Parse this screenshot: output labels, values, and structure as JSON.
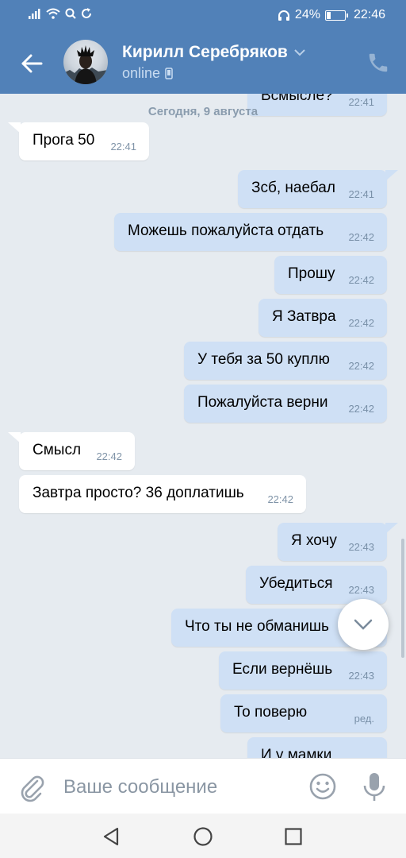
{
  "status_bar": {
    "battery": "24%",
    "battery_level": 0.24,
    "time": "22:46"
  },
  "header": {
    "contact_name": "Кирилл Серебряков",
    "status": "online",
    "icons": [
      "back-arrow-icon",
      "chevron-down-icon",
      "mobile-icon",
      "phone-icon"
    ]
  },
  "chat": {
    "date_separator": "Сегодня, 9 августа",
    "partial_top": {
      "text": "Всмысле?",
      "time": "22:41"
    },
    "messages": [
      {
        "dir": "in",
        "text": "Прога 50",
        "time": "22:41",
        "tail": true
      },
      {
        "dir": "out",
        "text": "Зсб, наебал",
        "time": "22:41",
        "tail": true
      },
      {
        "dir": "out",
        "text": "Можешь пожалуйста отдать",
        "time": "22:42",
        "tail": false
      },
      {
        "dir": "out",
        "text": "Прошу",
        "time": "22:42",
        "tail": false
      },
      {
        "dir": "out",
        "text": "Я Затвра",
        "time": "22:42",
        "tail": false
      },
      {
        "dir": "out",
        "text": "У тебя за 50 куплю",
        "time": "22:42",
        "tail": false
      },
      {
        "dir": "out",
        "text": "Пожалуйста верни",
        "time": "22:42",
        "tail": false
      },
      {
        "dir": "in",
        "text": "Смысл",
        "time": "22:42",
        "tail": true
      },
      {
        "dir": "in",
        "text": "Завтра просто? 36 доплатишь",
        "time": "22:42",
        "tail": false
      },
      {
        "dir": "out",
        "text": "Я хочу",
        "time": "22:43",
        "tail": true
      },
      {
        "dir": "out",
        "text": "Убедиться",
        "time": "22:43",
        "tail": false
      },
      {
        "dir": "out",
        "text": "Что ты не обманишь",
        "time": "22:43",
        "tail": false
      },
      {
        "dir": "out",
        "text": "Если вернёшь",
        "time": "22:43",
        "tail": false
      },
      {
        "dir": "out",
        "text": "То поверю",
        "time": "ред.",
        "tail": false
      },
      {
        "dir": "out",
        "text": "И у мамки",
        "time": "",
        "tail": false
      }
    ]
  },
  "input": {
    "placeholder": "Ваше сообщение",
    "value": ""
  },
  "colors": {
    "header": "#5181b8",
    "background": "#e6ebf0",
    "incoming_bubble": "#ffffff",
    "outgoing_bubble": "#cfe0f5",
    "icon_gray": "#99a2ad"
  }
}
